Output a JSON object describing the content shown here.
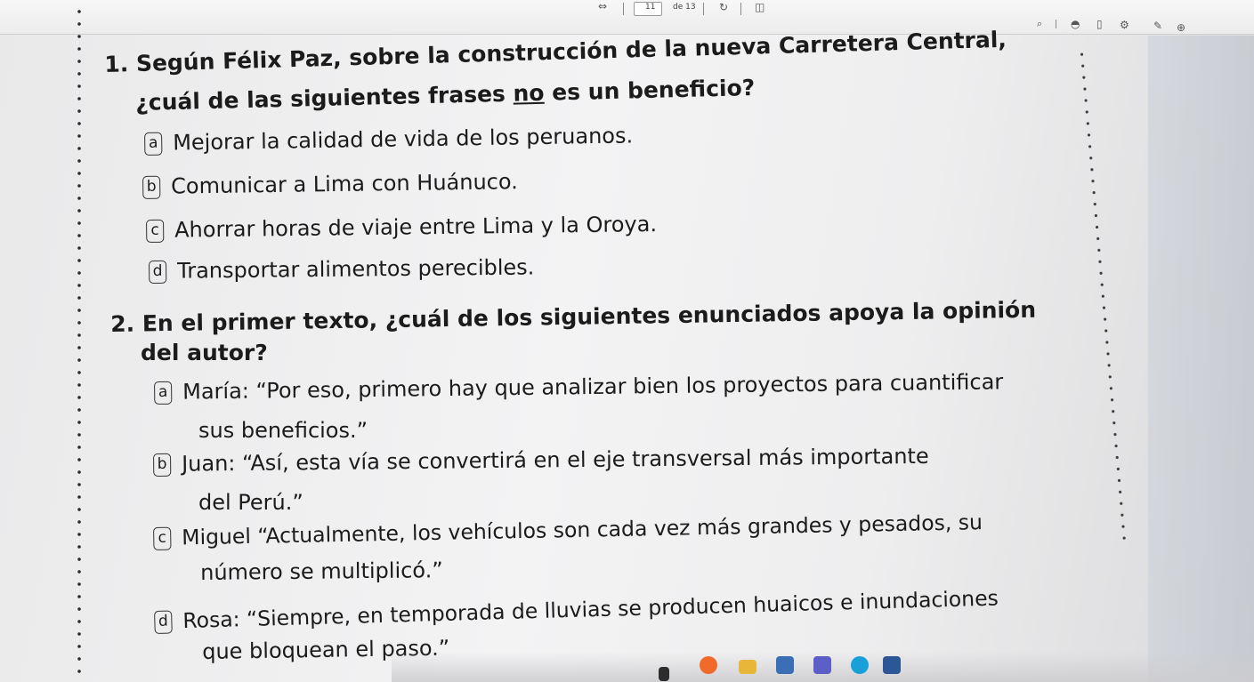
{
  "toolbar": {
    "page_current": "11",
    "page_total": "de 13",
    "icons": [
      "fit-page-icon",
      "rotate-icon",
      "two-page-icon",
      "search-icon",
      "shield-icon",
      "bookmark-icon",
      "settings-icon",
      "draw-icon",
      "more-icon"
    ]
  },
  "questions": [
    {
      "line1": "1. Según Félix Paz, sobre la construcción de la nueva Carretera Central,",
      "line2_pre": "¿cuál de las siguientes frases ",
      "line2_u": "no",
      "line2_post": " es un beneficio?",
      "options": [
        {
          "letter": "a",
          "text": "Mejorar la calidad de vida de los peruanos."
        },
        {
          "letter": "b",
          "text": "Comunicar a Lima con Huánuco."
        },
        {
          "letter": "c",
          "text": "Ahorrar horas de viaje entre Lima y la Oroya."
        },
        {
          "letter": "d",
          "text": "Transportar alimentos perecibles."
        }
      ]
    },
    {
      "line1": "2. En el primer texto, ¿cuál de los siguientes enunciados apoya la opinión",
      "line2": "del autor?",
      "options": [
        {
          "letter": "a",
          "text1": "María: “Por eso, primero hay que analizar bien los proyectos para cuantificar",
          "text2": "sus beneficios.”"
        },
        {
          "letter": "b",
          "text1": "Juan: “Así, esta vía se convertirá en el eje transversal más importante",
          "text2": "del Perú.”"
        },
        {
          "letter": "c",
          "text1": "Miguel “Actualmente, los vehículos son cada vez más grandes y pesados, su",
          "text2": "número se multiplicó.”"
        },
        {
          "letter": "d",
          "text1": "Rosa: “Siempre, en temporada de lluvias se producen huaicos e inundaciones",
          "text2": "que bloquean el paso.”"
        }
      ]
    }
  ],
  "taskbar": {
    "apps": [
      "file-explorer-icon",
      "brave-browser-icon",
      "folder-icon",
      "store-icon",
      "teams-icon",
      "edge-icon",
      "word-icon"
    ]
  }
}
